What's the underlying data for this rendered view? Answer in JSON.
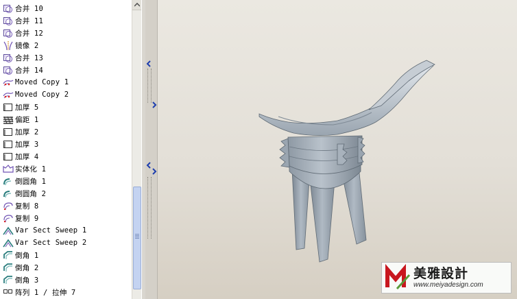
{
  "model_tree": {
    "items": [
      {
        "label": "合并 10",
        "icon": "merge-icon"
      },
      {
        "label": "合并 11",
        "icon": "merge-icon"
      },
      {
        "label": "合并 12",
        "icon": "merge-icon"
      },
      {
        "label": "镜像 2",
        "icon": "mirror-icon"
      },
      {
        "label": "合并 13",
        "icon": "merge-icon"
      },
      {
        "label": "合并 14",
        "icon": "merge-icon"
      },
      {
        "label": "Moved Copy 1",
        "icon": "moved-copy-icon"
      },
      {
        "label": "Moved Copy 2",
        "icon": "moved-copy-icon"
      },
      {
        "label": "加厚 5",
        "icon": "thicken-icon"
      },
      {
        "label": "偏距 1",
        "icon": "offset-icon"
      },
      {
        "label": "加厚 2",
        "icon": "thicken-icon"
      },
      {
        "label": "加厚 3",
        "icon": "thicken-icon"
      },
      {
        "label": "加厚 4",
        "icon": "thicken-icon"
      },
      {
        "label": "实体化 1",
        "icon": "solidify-icon"
      },
      {
        "label": "倒圆角 1",
        "icon": "round-icon"
      },
      {
        "label": "倒圆角 2",
        "icon": "round-icon"
      },
      {
        "label": "复制 8",
        "icon": "copy-icon"
      },
      {
        "label": "复制 9",
        "icon": "copy-icon"
      },
      {
        "label": "Var Sect Sweep 1",
        "icon": "var-sect-sweep-icon"
      },
      {
        "label": "Var Sect Sweep 2",
        "icon": "var-sect-sweep-icon"
      },
      {
        "label": "倒角 1",
        "icon": "chamfer-icon"
      },
      {
        "label": "倒角 2",
        "icon": "chamfer-icon"
      },
      {
        "label": "倒角 3",
        "icon": "chamfer-icon"
      },
      {
        "label": "阵列 1 / 拉伸 7",
        "icon": "pattern-icon"
      }
    ]
  },
  "watermark": {
    "title": "美雅設計",
    "url": "www.meiyadesign.com"
  },
  "colors": {
    "model_body": "#a9b3bd",
    "model_shadow": "#7f8a95",
    "model_highlight": "#dfe4e9",
    "scroll_thumb": "#c4d3f1",
    "splitter_arrow": "#1f3fae",
    "watermark_red": "#c8171f",
    "watermark_green": "#5a9a3a"
  }
}
